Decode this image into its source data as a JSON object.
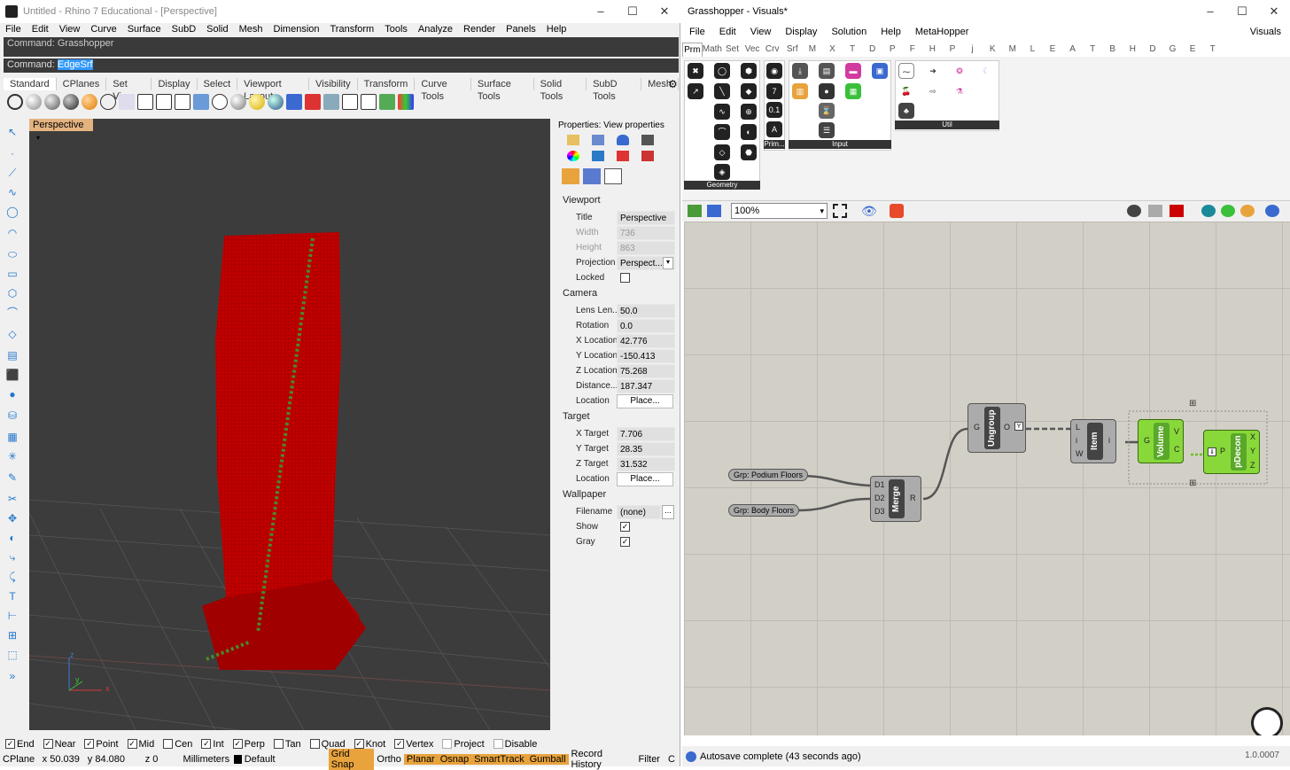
{
  "rhino": {
    "title": "Untitled - Rhino 7 Educational - [Perspective]",
    "menu": [
      "File",
      "Edit",
      "View",
      "Curve",
      "Surface",
      "SubD",
      "Solid",
      "Mesh",
      "Dimension",
      "Transform",
      "Tools",
      "Analyze",
      "Render",
      "Panels",
      "Help"
    ],
    "command_history": "Command: Grasshopper",
    "command_prompt": "Command:",
    "command_input": "EdgeSrf",
    "toolbar_tabs": [
      "Standard",
      "CPlanes",
      "Set View",
      "Display",
      "Select",
      "Viewport Layout",
      "Visibility",
      "Transform",
      "Curve Tools",
      "Surface Tools",
      "Solid Tools",
      "SubD Tools",
      "Mesh"
    ],
    "viewport_tab": "Perspective",
    "axis_labels": {
      "z": "z",
      "y": "y",
      "x": "x"
    },
    "properties": {
      "header": "Properties: View properties",
      "section_viewport": "Viewport",
      "title_label": "Title",
      "title_value": "Perspective",
      "width_label": "Width",
      "width_value": "736",
      "height_label": "Height",
      "height_value": "863",
      "projection_label": "Projection",
      "projection_value": "Perspect...",
      "locked_label": "Locked",
      "section_camera": "Camera",
      "lens_label": "Lens Len...",
      "lens_value": "50.0",
      "rotation_label": "Rotation",
      "rotation_value": "0.0",
      "xloc_label": "X Location",
      "xloc_value": "42.776",
      "yloc_label": "Y Location",
      "yloc_value": "-150.413",
      "zloc_label": "Z Location",
      "zloc_value": "75.268",
      "dist_label": "Distance...",
      "dist_value": "187.347",
      "location_label": "Location",
      "place_button": "Place...",
      "section_target": "Target",
      "xt_label": "X Target",
      "xt_value": "7.706",
      "yt_label": "Y Target",
      "yt_value": "28.35",
      "zt_label": "Z Target",
      "zt_value": "31.532",
      "tlocation_label": "Location",
      "tplace_button": "Place...",
      "section_wallpaper": "Wallpaper",
      "filename_label": "Filename",
      "filename_value": "(none)",
      "browse_button": "...",
      "show_label": "Show",
      "gray_label": "Gray"
    },
    "osnaps": [
      {
        "label": "End",
        "checked": true
      },
      {
        "label": "Near",
        "checked": true
      },
      {
        "label": "Point",
        "checked": true
      },
      {
        "label": "Mid",
        "checked": true
      },
      {
        "label": "Cen",
        "checked": false
      },
      {
        "label": "Int",
        "checked": true
      },
      {
        "label": "Perp",
        "checked": true
      },
      {
        "label": "Tan",
        "checked": false
      },
      {
        "label": "Quad",
        "checked": false
      },
      {
        "label": "Knot",
        "checked": true
      },
      {
        "label": "Vertex",
        "checked": true
      },
      {
        "label": "Project",
        "checked": false
      },
      {
        "label": "Disable",
        "checked": false
      }
    ],
    "status": {
      "cplane": "CPlane",
      "x": "x 50.039",
      "y": "y 84.080",
      "z": "z 0",
      "units": "Millimeters",
      "layer": "Default",
      "grid_snap": "Grid Snap",
      "ortho": "Ortho",
      "planar": "Planar",
      "osnap": "Osnap",
      "smarttrack": "SmartTrack",
      "gumball": "Gumball",
      "record_history": "Record History",
      "filter": "Filter",
      "filter_cut": "C"
    }
  },
  "grasshopper": {
    "title": "Grasshopper - Visuals*",
    "menu": [
      "File",
      "Edit",
      "View",
      "Display",
      "Solution",
      "Help",
      "MetaHopper"
    ],
    "doc_name": "Visuals",
    "tabs": [
      "Prm",
      "Math",
      "Set",
      "Vec",
      "Crv",
      "Srf",
      "M",
      "X",
      "T",
      "D",
      "P",
      "F",
      "H",
      "P",
      "j",
      "K",
      "M",
      "L",
      "E",
      "A",
      "T",
      "B",
      "H",
      "D",
      "G",
      "E",
      "T"
    ],
    "ribbon_groups": {
      "geometry": "Geometry",
      "primitive": "Prim...",
      "input": "Input",
      "util": "Util"
    },
    "zoom": "100%",
    "components": {
      "ungroup": {
        "label": "Ungroup",
        "in": "G",
        "out": "O"
      },
      "merge": {
        "label": "Merge",
        "inputs": [
          "D1",
          "D2",
          "D3"
        ],
        "out": "R"
      },
      "item": {
        "label": "Item",
        "inputs": [
          "L",
          "i",
          "W"
        ],
        "out": "i"
      },
      "volume": {
        "label": "Volume",
        "in": "G",
        "outs": [
          "V",
          "C"
        ]
      },
      "pdecon": {
        "label": "pDecon",
        "in": "P",
        "outs": [
          "X",
          "Y",
          "Z"
        ]
      }
    },
    "params": {
      "podium": "Grp: Podium Floors",
      "body": "Grp: Body Floors"
    },
    "status": "Autosave complete (43 seconds ago)",
    "version": "1.0.0007"
  },
  "colors": {
    "tower_red": "#cc0000",
    "green_component": "#88d83a",
    "snap_orange": "#e8a33d"
  }
}
